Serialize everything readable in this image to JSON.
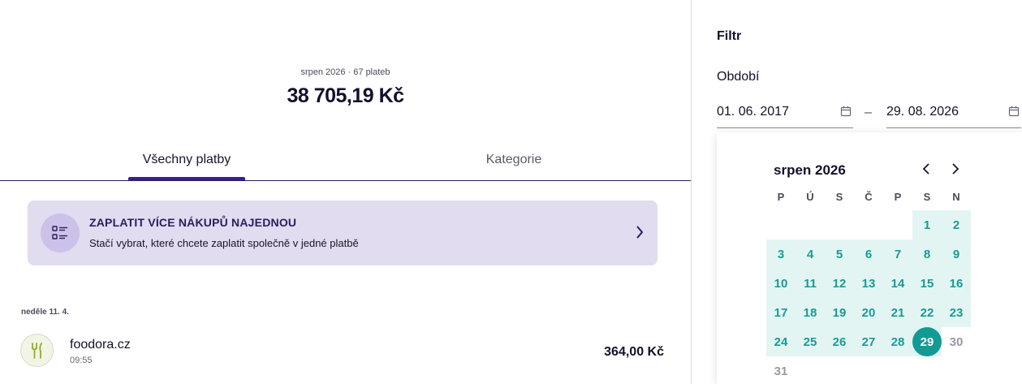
{
  "summary": {
    "meta": "srpen 2026 · 67 plateb",
    "total": "38 705,19 Kč"
  },
  "tabs": {
    "all": "Všechny platby",
    "categories": "Kategorie"
  },
  "banner": {
    "title": "ZAPLATIT VÍCE NÁKUPŮ NAJEDNOU",
    "subtitle": "Stačí vybrat, které chcete zaplatit společně v jedné platbě",
    "icon": "checklist-icon"
  },
  "transactions": {
    "day_label": "neděle 11. 4.",
    "items": [
      {
        "name": "foodora.cz",
        "time": "09:55",
        "amount": "364,00 Kč",
        "icon": "fork-knife-icon"
      }
    ]
  },
  "filter": {
    "title": "Filtr",
    "period_label": "Období",
    "date_from": "01. 06. 2017",
    "date_to": "29. 08. 2026",
    "separator": "–"
  },
  "calendar": {
    "month": "srpen 2026",
    "weekdays": [
      "P",
      "Ú",
      "S",
      "Č",
      "P",
      "S",
      "N"
    ],
    "selected_day": "29",
    "days": [
      "1",
      "2",
      "3",
      "4",
      "5",
      "6",
      "7",
      "8",
      "9",
      "10",
      "11",
      "12",
      "13",
      "14",
      "15",
      "16",
      "17",
      "18",
      "19",
      "20",
      "21",
      "22",
      "23",
      "24",
      "25",
      "26",
      "27",
      "28",
      "29",
      "30",
      "31"
    ]
  },
  "colors": {
    "accent": "#3a1e8c",
    "range": "#e3f5f3",
    "selected": "#149a94",
    "banner_bg": "#e1dcef"
  }
}
